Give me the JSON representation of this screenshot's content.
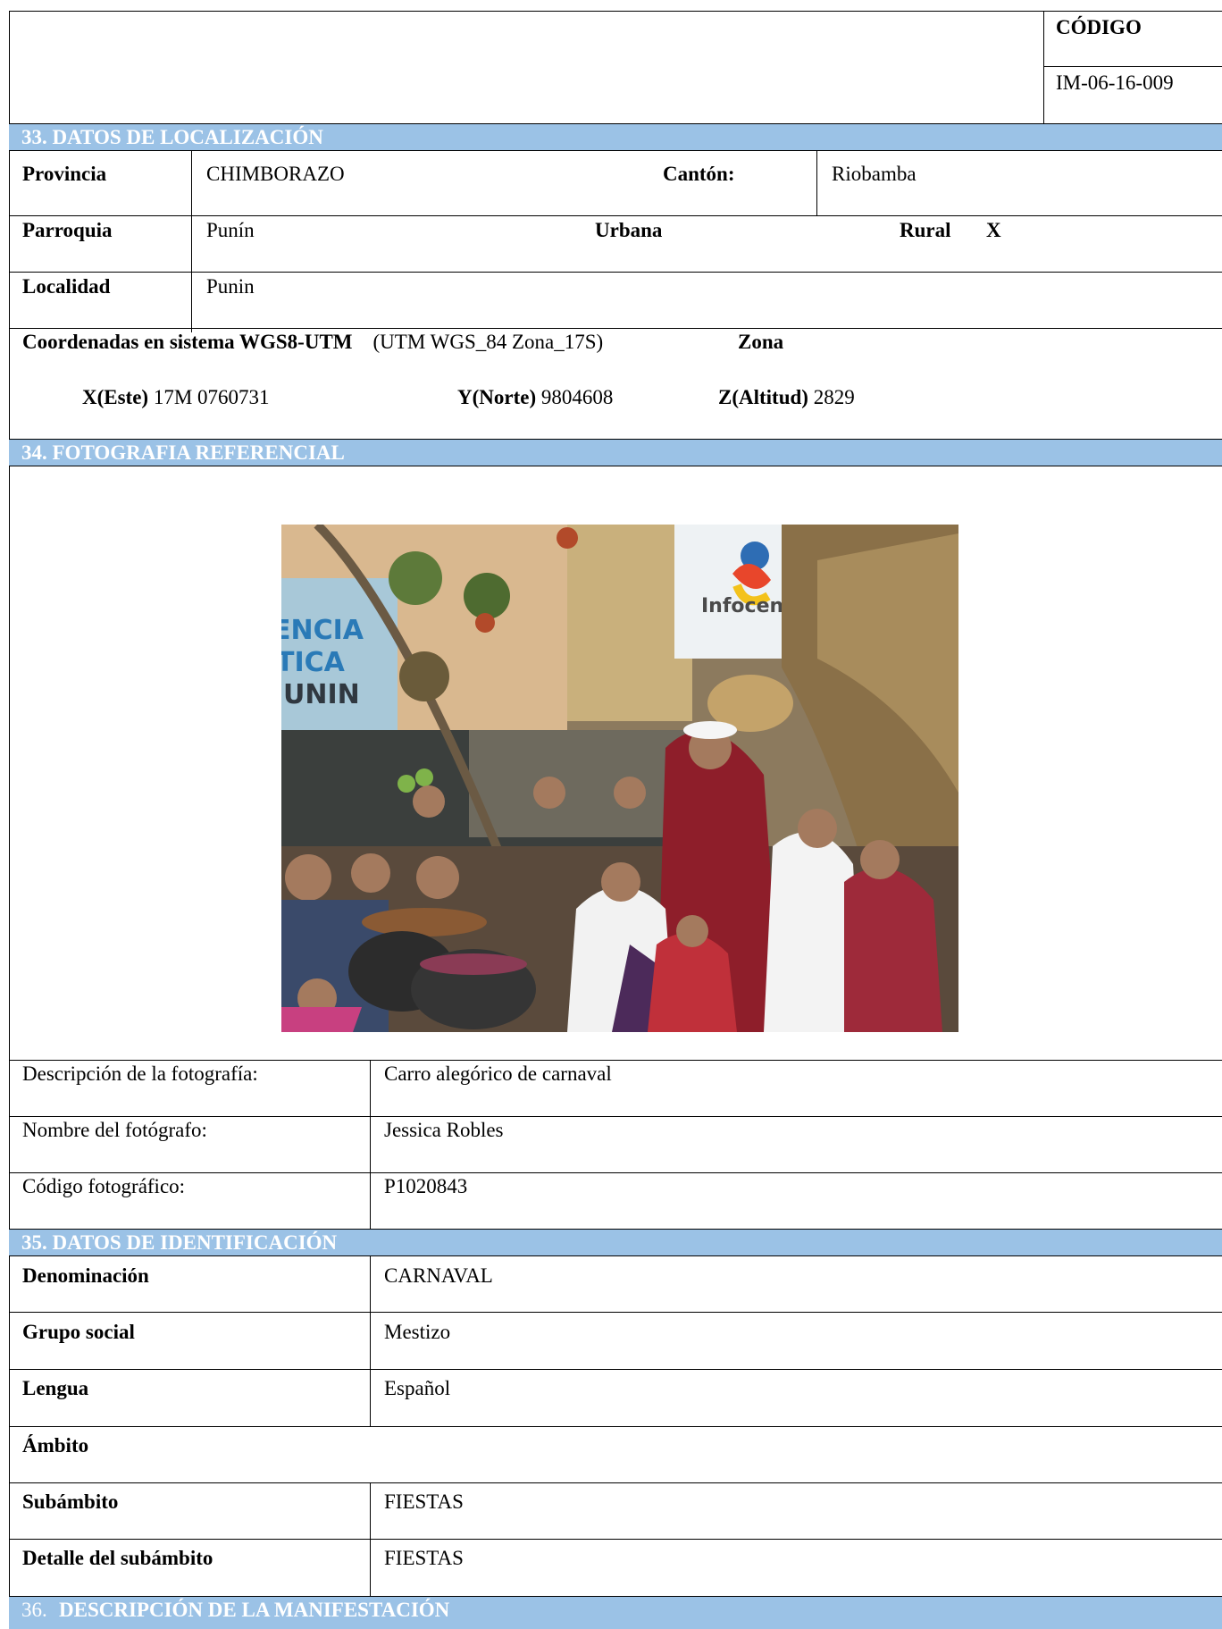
{
  "header": {
    "code_label": "CÓDIGO",
    "code_value": "IM-06-16-009"
  },
  "section33": {
    "title": "33.  DATOS DE LOCALIZACIÓN",
    "provincia_label": "Provincia",
    "provincia_value": "CHIMBORAZO",
    "canton_label": "Cantón:",
    "canton_value": "Riobamba",
    "parroquia_label": "Parroquia",
    "parroquia_value": "Punín",
    "urbana_label": "Urbana",
    "rural_label": "Rural",
    "rural_mark": "X",
    "localidad_label": "Localidad",
    "localidad_value": "Punin",
    "coords_label": "Coordenadas en sistema WGS8-UTM",
    "coords_system": "(UTM WGS_84 Zona_17S)",
    "zona_label": "Zona",
    "x_label": "X(Este)",
    "x_value": "17M  0760731",
    "y_label": "Y(Norte)",
    "y_value": "9804608",
    "z_label": "Z(Altitud)",
    "z_value": "2829"
  },
  "section34": {
    "title": "34.  FOTOGRAFIA REFERENCIAL",
    "photo_sign_text": "Infocen",
    "photo_wall_text": [
      "ENCIA",
      "TICA",
      "UNIN"
    ],
    "desc_label": "Descripción de la fotografía:",
    "desc_value": "Carro alegórico de carnaval",
    "photographer_label": "Nombre del fotógrafo:",
    "photographer_value": "Jessica Robles",
    "photo_code_label": "Código fotográfico:",
    "photo_code_value": "P1020843"
  },
  "section35": {
    "title": "35.  DATOS DE IDENTIFICACIÓN",
    "denominacion_label": "Denominación",
    "denominacion_value": "CARNAVAL",
    "grupo_label": "Grupo social",
    "grupo_value": "Mestizo",
    "lengua_label": "Lengua",
    "lengua_value": "Español",
    "ambito_label": "Ámbito",
    "subambito_label": "Subámbito",
    "subambito_value": "FIESTAS",
    "detalle_label": "Detalle del subámbito",
    "detalle_value": "FIESTAS"
  },
  "section36": {
    "number": "36.",
    "title": "DESCRIPCIÓN DE LA MANIFESTACIÓN"
  },
  "colors": {
    "band": "#9bc2e6",
    "band_text": "#ffffff"
  }
}
